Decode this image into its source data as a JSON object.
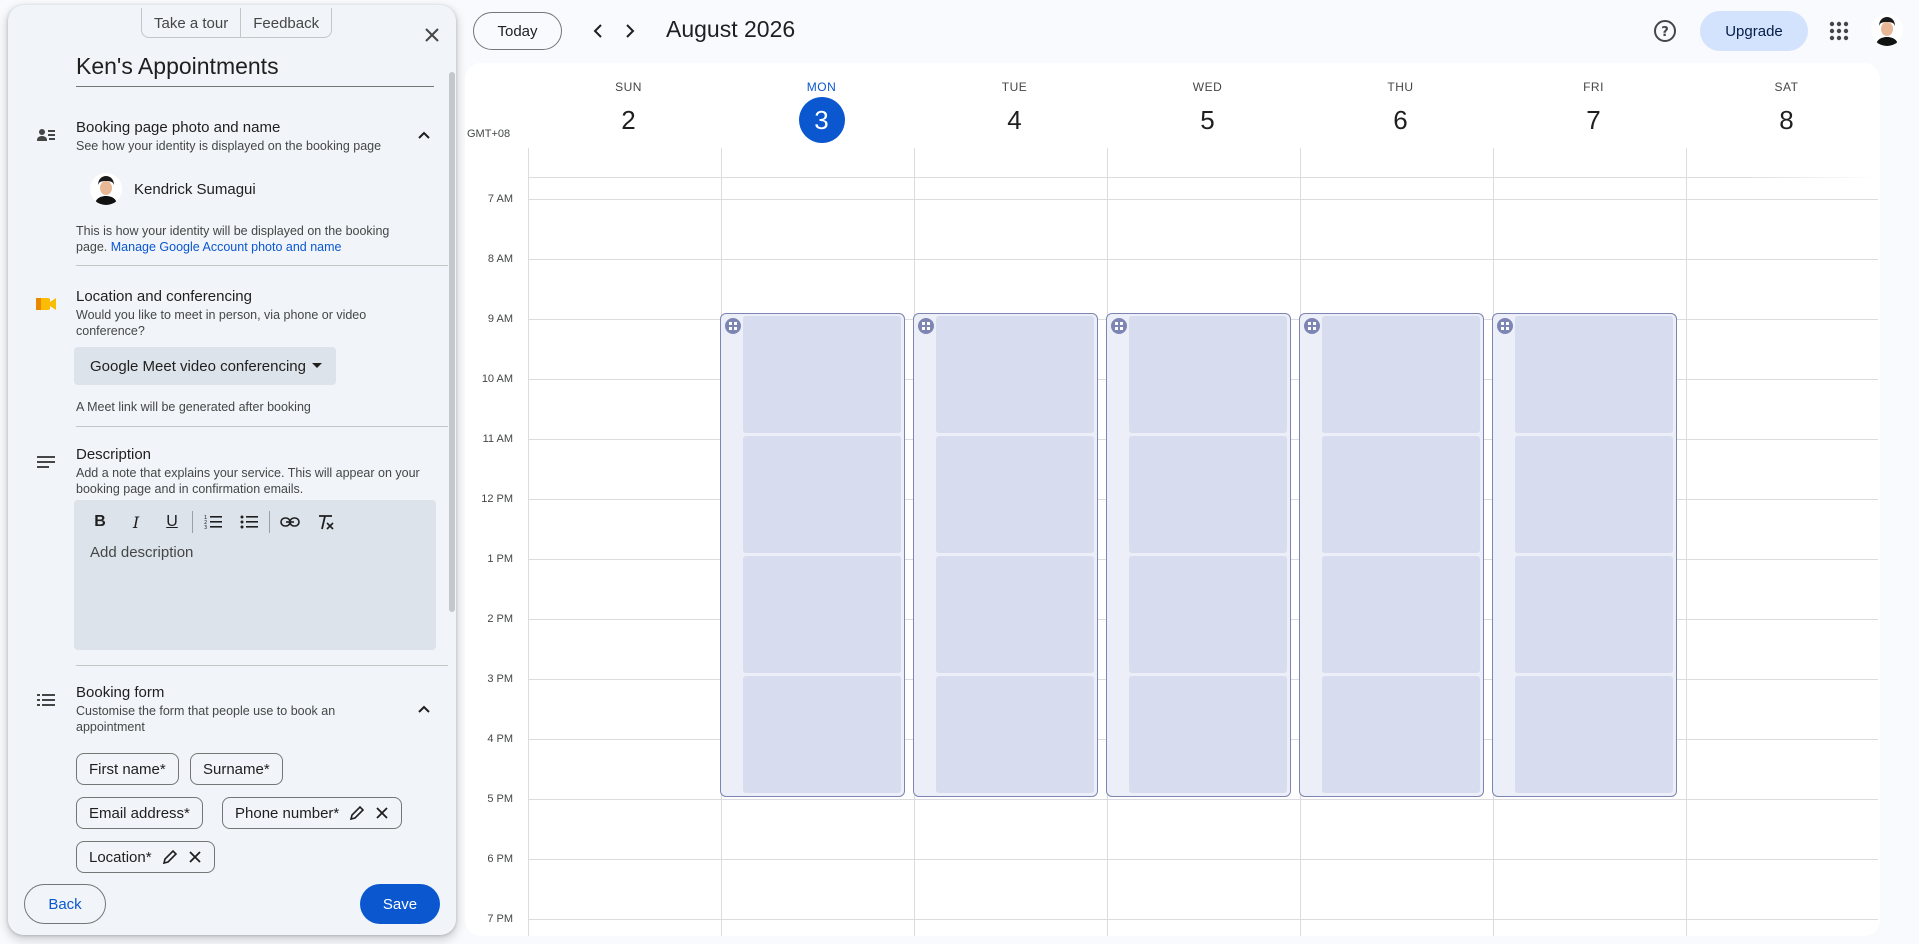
{
  "panel": {
    "tour_label": "Take a tour",
    "feedback_label": "Feedback",
    "title": "Ken's Appointments",
    "photo_section": {
      "heading": "Booking page photo and name",
      "subtitle": "See how your identity is displayed on the booking page",
      "user_name": "Kendrick Sumagui",
      "note": "This is how your identity will be displayed on the booking page.",
      "link": "Manage Google Account photo and name"
    },
    "location_section": {
      "heading": "Location and conferencing",
      "subtitle": "Would you like to meet in person, via phone or video conference?",
      "selected": "Google Meet video conferencing",
      "note": "A Meet link will be generated after booking"
    },
    "description_section": {
      "heading": "Description",
      "subtitle": "Add a note that explains your service. This will appear on your booking page and in confirmation emails.",
      "placeholder": "Add description",
      "toolbar": {
        "bold": "B",
        "italic": "I",
        "underline": "U"
      }
    },
    "form_section": {
      "heading": "Booking form",
      "subtitle": "Customise the form that people use to book an appointment",
      "fields": [
        "First name*",
        "Surname*",
        "Email address*",
        "Phone number*",
        "Location*"
      ]
    },
    "back_label": "Back",
    "save_label": "Save"
  },
  "header": {
    "today_label": "Today",
    "month": "August 2026",
    "upgrade_label": "Upgrade"
  },
  "calendar": {
    "timezone": "GMT+08",
    "days": [
      {
        "name": "SUN",
        "date": "2"
      },
      {
        "name": "MON",
        "date": "3"
      },
      {
        "name": "TUE",
        "date": "4"
      },
      {
        "name": "WED",
        "date": "5"
      },
      {
        "name": "THU",
        "date": "6"
      },
      {
        "name": "FRI",
        "date": "7"
      },
      {
        "name": "SAT",
        "date": "8"
      }
    ],
    "times": [
      "7 AM",
      "8 AM",
      "9 AM",
      "10 AM",
      "11 AM",
      "12 PM",
      "1 PM",
      "2 PM",
      "3 PM",
      "4 PM",
      "5 PM",
      "6 PM",
      "7 PM"
    ]
  },
  "colors": {
    "accent": "#0b57d0",
    "event_border": "#7c85b4",
    "event_slot": "#d8dcef"
  }
}
